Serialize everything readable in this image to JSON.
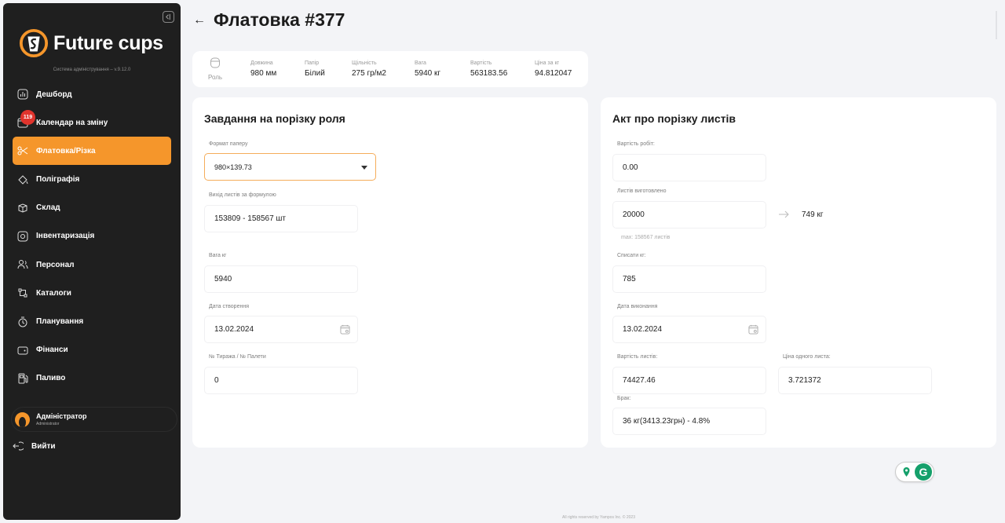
{
  "sidebar": {
    "brand": "Future cups",
    "version": "Система адміністрування – v.9.12.0",
    "items": [
      {
        "label": "Дешборд",
        "icon": "dashboard-icon"
      },
      {
        "label": "Календар на зміну",
        "icon": "calendar-icon",
        "badge": "119"
      },
      {
        "label": "Флатовка/Різка",
        "icon": "scissors-icon",
        "active": true
      },
      {
        "label": "Поліграфія",
        "icon": "paint-bucket-icon"
      },
      {
        "label": "Склад",
        "icon": "box-icon"
      },
      {
        "label": "Інвентаризація",
        "icon": "inventory-icon"
      },
      {
        "label": "Персонал",
        "icon": "people-icon"
      },
      {
        "label": "Каталоги",
        "icon": "catalog-icon"
      },
      {
        "label": "Планування",
        "icon": "planning-icon"
      },
      {
        "label": "Фінанси",
        "icon": "finance-icon"
      },
      {
        "label": "Паливо",
        "icon": "fuel-icon"
      }
    ],
    "user": {
      "name": "Адміністратор",
      "role": "Administrator"
    },
    "logout": "Вийти"
  },
  "header": {
    "title": "Флатовка #377"
  },
  "info": {
    "roll_label": "Роль",
    "columns": [
      {
        "label": "Довжина",
        "value": "980 мм"
      },
      {
        "label": "Папір",
        "value": "Білий"
      },
      {
        "label": "Щільність",
        "value": "275 гр/м2"
      },
      {
        "label": "Вага",
        "value": "5940 кг"
      },
      {
        "label": "Вартість",
        "value": "563183.56"
      },
      {
        "label": "Ціна за кг",
        "value": "94.812047"
      }
    ]
  },
  "task": {
    "title": "Завдання на порізку роля",
    "format_label": "Формат паперу",
    "format_value": "980×139.73",
    "output_label": "Вихід листів за формулою",
    "output_value": "153809 - 158567 шт",
    "weight_label": "Вага кг",
    "weight_value": "5940",
    "created_label": "Дата створення",
    "created_value": "13.02.2024",
    "batch_label": "№ Тиража / № Палети",
    "batch_value": "0"
  },
  "act": {
    "title": "Акт про порізку листів",
    "work_cost_label": "Вартість робіт:",
    "work_cost_value": "0.00",
    "sheets_label": "Листів виготовлено",
    "sheets_value": "20000",
    "sheets_weight": "749 кг",
    "sheets_hint": "max: 158567 листів",
    "writeoff_label": "Списати кг:",
    "writeoff_value": "785",
    "done_label": "Дата виконання",
    "done_value": "13.02.2024",
    "sheets_cost_label": "Вартість листів:",
    "sheets_cost_value": "74427.46",
    "unit_price_label": "Ціна одного листа:",
    "unit_price_value": "3.721372",
    "defect_label": "Брак:",
    "defect_value": "36 кг(3413.23грн) - 4.8%"
  },
  "footer": "All rights reserved by Yampos Inc. © 2023",
  "colors": {
    "accent": "#f5962b",
    "sidebar": "#1f1f1f",
    "badge": "#e0342d"
  }
}
